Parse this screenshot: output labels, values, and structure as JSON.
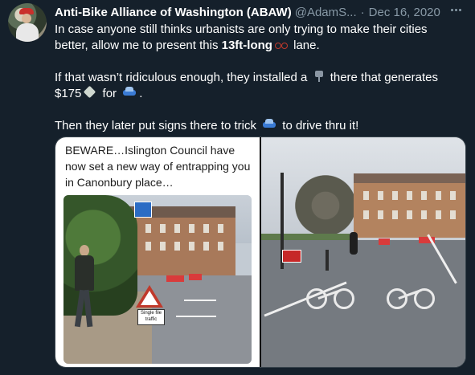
{
  "tweet": {
    "author_name": "Anti-Bike Alliance of Washington (ABAW)",
    "handle": "@AdamS...",
    "separator": "·",
    "date": "Dec 16, 2020",
    "paragraph1": {
      "part1": "In case anyone still thinks urbanists are only trying to make their cities better, allow me to present this ",
      "bold": "13ft-long",
      "part2": " lane."
    },
    "paragraph2": {
      "part1": "If that wasn’t ridiculous enough, they installed a ",
      "part2": " there that generates $175",
      "part3": " for ",
      "part4": "."
    },
    "paragraph3": {
      "part1": "Then they later put signs there to trick ",
      "part2": " to drive thru it!"
    },
    "emoji_icons": [
      "bicycle-emoji",
      "camera-emoji",
      "money-emoji",
      "car-emoji",
      "car-emoji"
    ]
  },
  "media": {
    "caption": "BEWARE…Islington Council have now set a new way of entrapping you in Canonbury place…",
    "sign_text": "Single file traffic"
  },
  "colors": {
    "background": "#15202b",
    "secondary_text": "#8899a6",
    "primary_text": "#ffffff"
  }
}
